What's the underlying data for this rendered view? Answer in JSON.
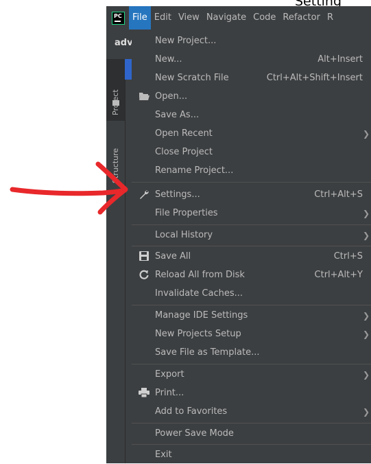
{
  "page_fragment": "Setting",
  "menubar": {
    "logo": "PC",
    "items": [
      "File",
      "Edit",
      "View",
      "Navigate",
      "Code",
      "Refactor",
      "R"
    ]
  },
  "toolbar": {
    "project_abbrev": "adv"
  },
  "side_tabs": {
    "project": "Project",
    "structure": "Structure"
  },
  "file_menu": {
    "new_project": "New Project...",
    "new": "New...",
    "new_shortcut": "Alt+Insert",
    "new_scratch": "New Scratch File",
    "new_scratch_shortcut": "Ctrl+Alt+Shift+Insert",
    "open": "Open...",
    "save_as": "Save As...",
    "open_recent": "Open Recent",
    "close_project": "Close Project",
    "rename_project": "Rename Project...",
    "settings": "Settings...",
    "settings_shortcut": "Ctrl+Alt+S",
    "file_properties": "File Properties",
    "local_history": "Local History",
    "save_all": "Save All",
    "save_all_shortcut": "Ctrl+S",
    "reload_all": "Reload All from Disk",
    "reload_all_shortcut": "Ctrl+Alt+Y",
    "invalidate_caches": "Invalidate Caches...",
    "manage_ide_settings": "Manage IDE Settings",
    "new_projects_setup": "New Projects Setup",
    "save_file_template": "Save File as Template...",
    "export": "Export",
    "print": "Print...",
    "add_to_favorites": "Add to Favorites",
    "power_save_mode": "Power Save Mode",
    "exit": "Exit"
  },
  "colors": {
    "menu_bg": "#3c3f41",
    "active_menu": "#2675bf",
    "annotation_arrow": "#e8282b"
  }
}
